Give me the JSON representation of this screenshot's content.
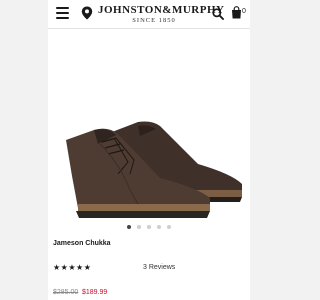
{
  "header": {
    "brand": "JOHNSTON&MURPHY",
    "since": "SINCE 1850",
    "bag_count": "0"
  },
  "icons": {
    "menu": "hamburger-menu-icon",
    "location": "map-pin-icon",
    "search": "search-icon",
    "bag": "shopping-bag-icon"
  },
  "carousel": {
    "count": 5,
    "active_index": 0
  },
  "product": {
    "name": "Jameson Chukka",
    "rating": 5,
    "stars": "★★★★★",
    "reviews": "3 Reviews",
    "price_original": "$285.00",
    "price_sale": "$189.99"
  },
  "colors": {
    "sale_price": "#c8102e",
    "boot": "#4e3c32",
    "sole": "#2a2522",
    "welt": "#8a6a4a"
  }
}
